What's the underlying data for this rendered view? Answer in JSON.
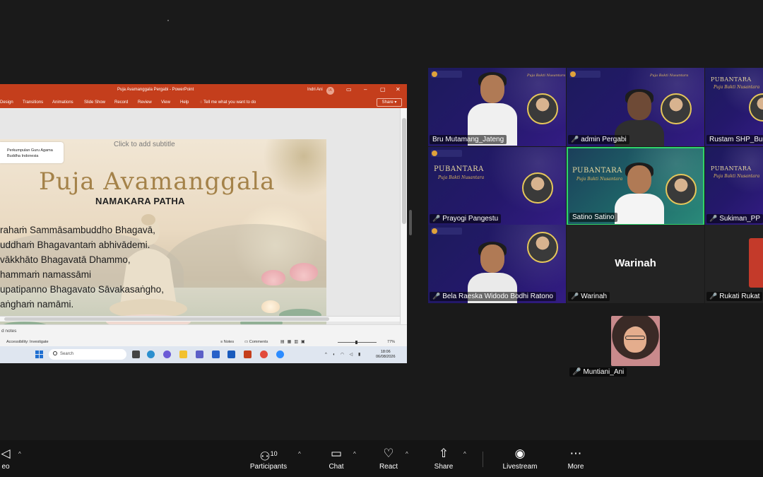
{
  "ppt": {
    "doc_title": "Puja Avamanggala Pergabi  -  PowerPoint",
    "user": "Indri Ani",
    "tabs": [
      "Design",
      "Transitions",
      "Animations",
      "Slide Show",
      "Record",
      "Review",
      "View",
      "Help"
    ],
    "tell_me": "Tell me what you want to do",
    "share_label": "Share",
    "notes_placeholder": "d notes",
    "status_accessibility": "Accessibility: Investigate",
    "status_notes": "Notes",
    "status_comments": "Comments",
    "zoom": "77%"
  },
  "slide": {
    "subtitle_placeholder": "Click to add subtitle",
    "org_line1": "Perkumpulan Guru Agama",
    "org_line2": "Buddha Indonesia",
    "title": "Puja Avamanggala",
    "subheading": "NAMAKARA PATHA",
    "lines": [
      "rahaṁ Sammāsambuddho Bhagavā,",
      "uddhaṁ Bhagavantaṁ abhivādemi.",
      "vākkhāto Bhagavatā Dhammo,",
      "hammaṁ namassāmi",
      "upatipanno Bhagavato Sāvakasaṅgho,",
      "aṅghaṁ namāmi."
    ]
  },
  "taskbar": {
    "search_placeholder": "Search",
    "time": "18:06",
    "date": "06/08/2026"
  },
  "gallery": {
    "poster_title": "PUBANTARA",
    "poster_sub": "Puja Bakti Nusantara",
    "participants": [
      "Bru Mutamang_Jateng",
      "admin Pergabi",
      "Rustam SHP_Bu",
      "Prayogi Pangestu",
      "Satino Satino",
      "Sukiman_PP",
      "Bela Raeska Widodo Bodhi Ratono",
      "Warinah",
      "Rukati Rukat",
      "Muntiani_Ani"
    ],
    "warinah_big": "Warinah"
  },
  "toolbar": {
    "video": "eo",
    "participants": "Participants",
    "participants_count": "10",
    "chat": "Chat",
    "react": "React",
    "share": "Share",
    "livestream": "Livestream",
    "more": "More"
  }
}
